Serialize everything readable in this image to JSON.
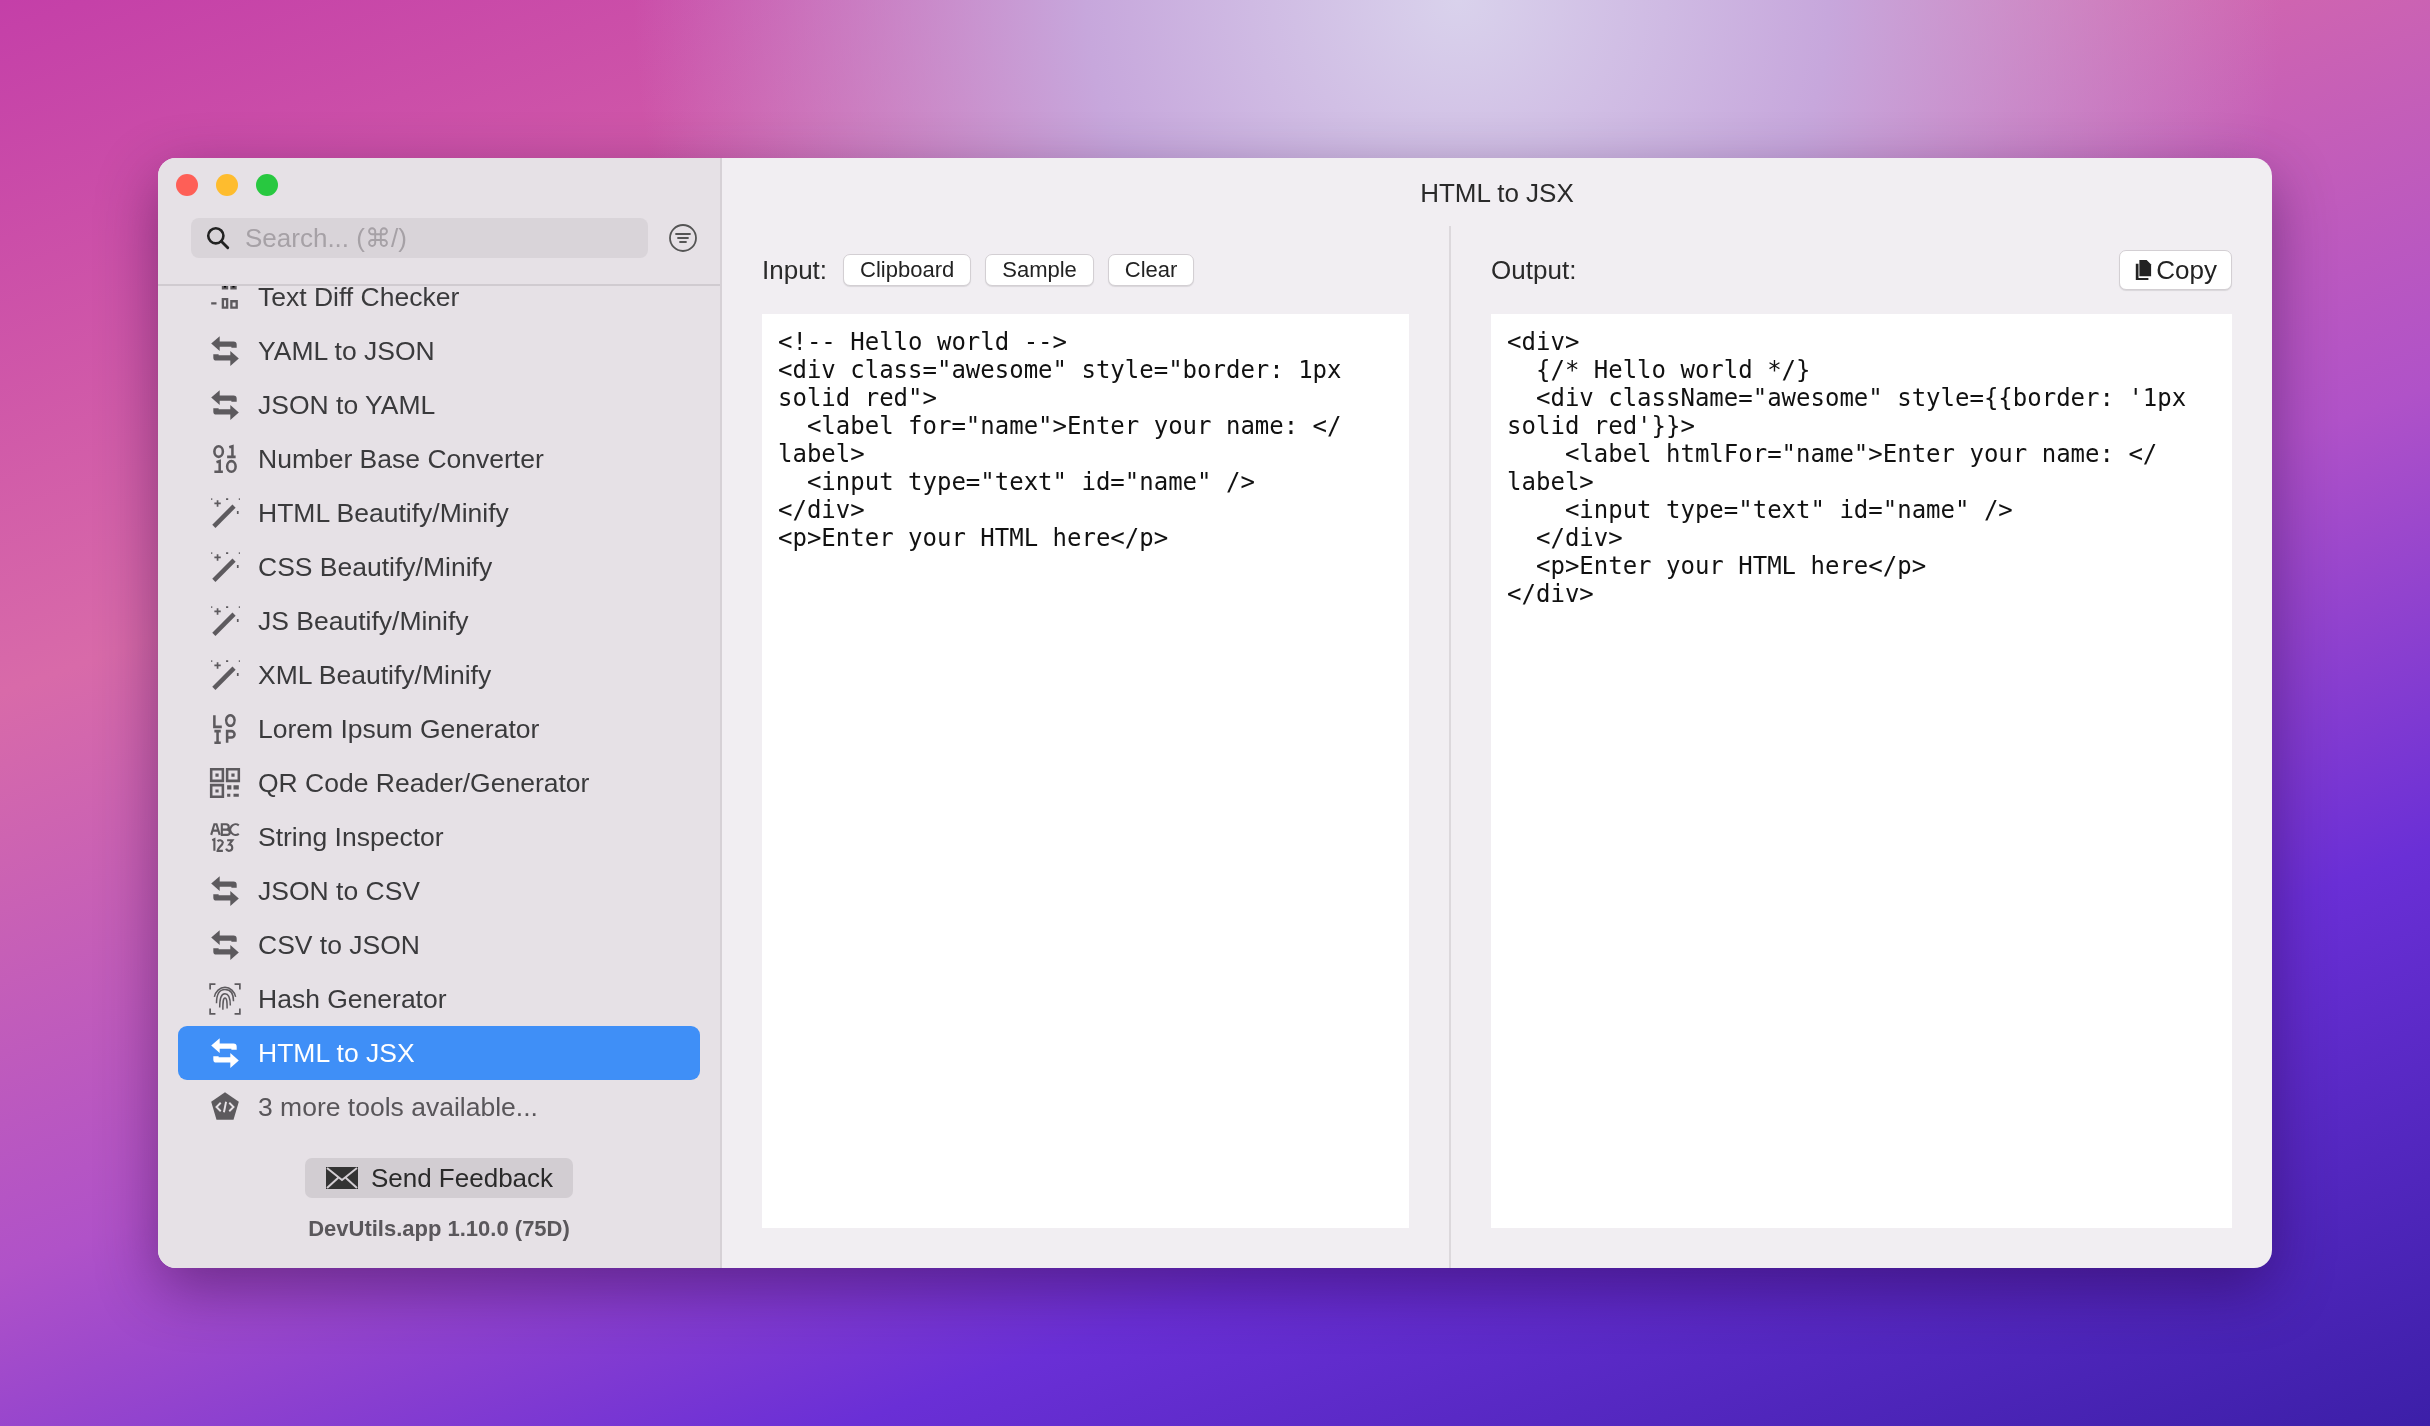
{
  "window": {
    "title": "HTML to JSX"
  },
  "search": {
    "placeholder": "Search... (⌘/)"
  },
  "sidebar": {
    "items": [
      {
        "label": "Text Diff Checker",
        "kind": "diff",
        "selected": false
      },
      {
        "label": "YAML to JSON",
        "kind": "swap",
        "selected": false
      },
      {
        "label": "JSON to YAML",
        "kind": "swap",
        "selected": false
      },
      {
        "label": "Number Base Converter",
        "kind": "binary",
        "selected": false
      },
      {
        "label": "HTML Beautify/Minify",
        "kind": "wand",
        "selected": false
      },
      {
        "label": "CSS Beautify/Minify",
        "kind": "wand",
        "selected": false
      },
      {
        "label": "JS Beautify/Minify",
        "kind": "wand",
        "selected": false
      },
      {
        "label": "XML Beautify/Minify",
        "kind": "wand",
        "selected": false
      },
      {
        "label": "Lorem Ipsum Generator",
        "kind": "lorem",
        "selected": false
      },
      {
        "label": "QR Code Reader/Generator",
        "kind": "qr",
        "selected": false
      },
      {
        "label": "String Inspector",
        "kind": "abc",
        "selected": false
      },
      {
        "label": "JSON to CSV",
        "kind": "swap",
        "selected": false
      },
      {
        "label": "CSV to JSON",
        "kind": "swap",
        "selected": false
      },
      {
        "label": "Hash Generator",
        "kind": "fingerprint",
        "selected": false
      },
      {
        "label": "HTML to JSX",
        "kind": "swap",
        "selected": true
      },
      {
        "label": "3 more tools available...",
        "kind": "more",
        "selected": false
      }
    ],
    "feedback_button": "Send Feedback",
    "version": "DevUtils.app 1.10.0 (75D)"
  },
  "input": {
    "label": "Input:",
    "buttons": [
      "Clipboard",
      "Sample",
      "Clear"
    ],
    "lines": [
      "<!-- Hello world -->",
      "<div class=\"awesome\" style=\"border: 1px",
      "solid red\">",
      "  <label for=\"name\">Enter your name: </",
      "label>",
      "  <input type=\"text\" id=\"name\" />",
      "</div>",
      "<p>Enter your HTML here</p>"
    ]
  },
  "output": {
    "label": "Output:",
    "copy_button": "Copy",
    "lines": [
      "<div>",
      "  {/* Hello world */}",
      "  <div className=\"awesome\" style={{border: '1px",
      "solid red'}}>",
      "    <label htmlFor=\"name\">Enter your name: </",
      "label>",
      "    <input type=\"text\" id=\"name\" />",
      "  </div>",
      "  <p>Enter your HTML here</p>",
      "</div>"
    ]
  }
}
